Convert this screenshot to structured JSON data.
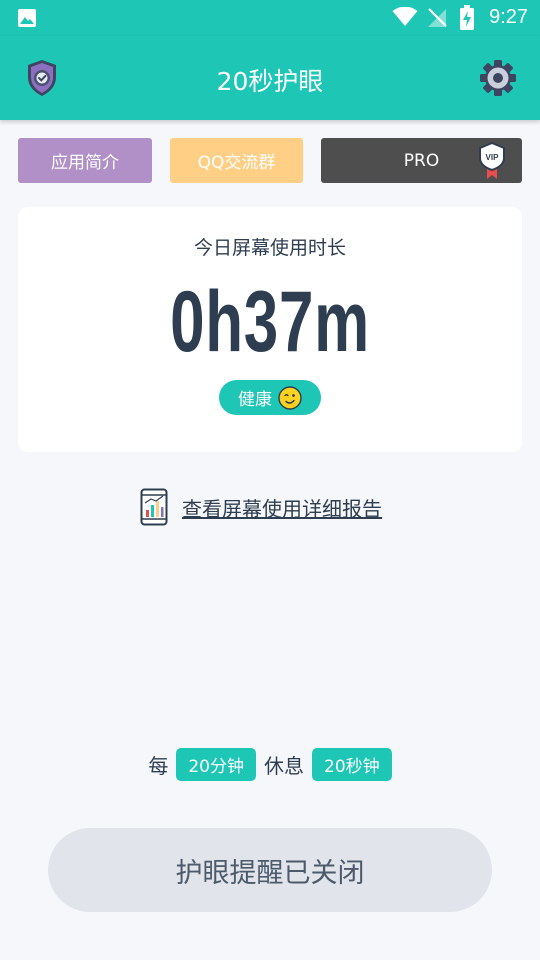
{
  "status_bar": {
    "time": "9:27"
  },
  "app_bar": {
    "title": "20秒护眼"
  },
  "chips": {
    "intro": "应用简介",
    "qq_group": "QQ交流群",
    "pro": "PRO",
    "vip_badge": "VIP"
  },
  "usage_card": {
    "title": "今日屏幕使用时长",
    "duration": "0h37m",
    "health_label": "健康"
  },
  "report_link": {
    "label": "查看屏幕使用详细报告"
  },
  "rule": {
    "every": "每",
    "interval": "20分钟",
    "rest": "休息",
    "rest_duration": "20秒钟"
  },
  "reminder_button": {
    "label": "护眼提醒已关闭"
  },
  "colors": {
    "teal": "#1ec6b6",
    "chip_intro": "#b090c6",
    "chip_qq": "#ffcf86",
    "chip_pro": "#4e4e4e",
    "text_dark": "#2e3d4f"
  }
}
